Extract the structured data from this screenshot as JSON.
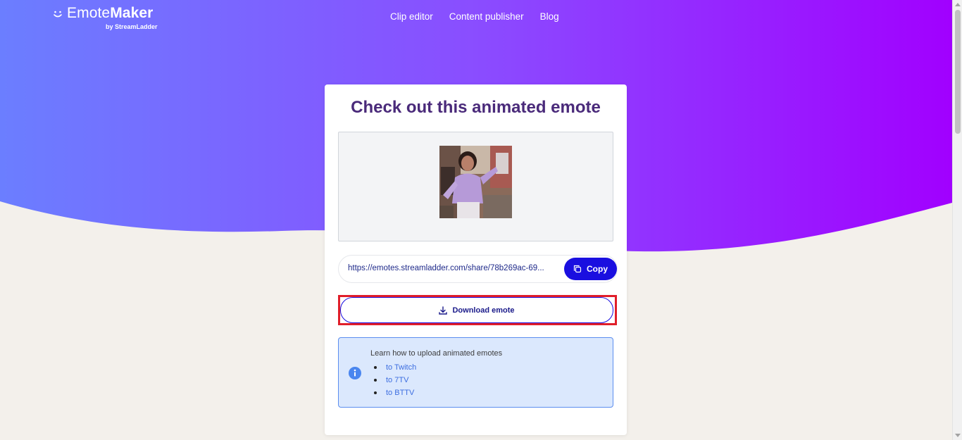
{
  "header": {
    "logo": {
      "name_light": "Emote",
      "name_bold": "Maker",
      "by": "by StreamLadder"
    },
    "nav": [
      {
        "label": "Clip editor"
      },
      {
        "label": "Content publisher"
      },
      {
        "label": "Blog"
      }
    ]
  },
  "card": {
    "title": "Check out this animated emote",
    "share": {
      "url": "https://emotes.streamladder.com/share/78b269ac-69...",
      "copy_label": "Copy",
      "copy_icon": "copy-icon"
    },
    "download": {
      "label": "Download emote",
      "icon": "download-icon"
    },
    "info": {
      "icon": "info-icon",
      "title": "Learn how to upload animated emotes",
      "links": [
        {
          "label": "to Twitch"
        },
        {
          "label": "to 7TV"
        },
        {
          "label": "to BTTV"
        }
      ]
    }
  },
  "colors": {
    "gradient_start": "#6c7bff",
    "gradient_end": "#a100ff",
    "primary": "#1a0fe0",
    "title": "#4a2a7a",
    "highlight": "#e01e2a",
    "info_bg": "#dbe8fd"
  }
}
